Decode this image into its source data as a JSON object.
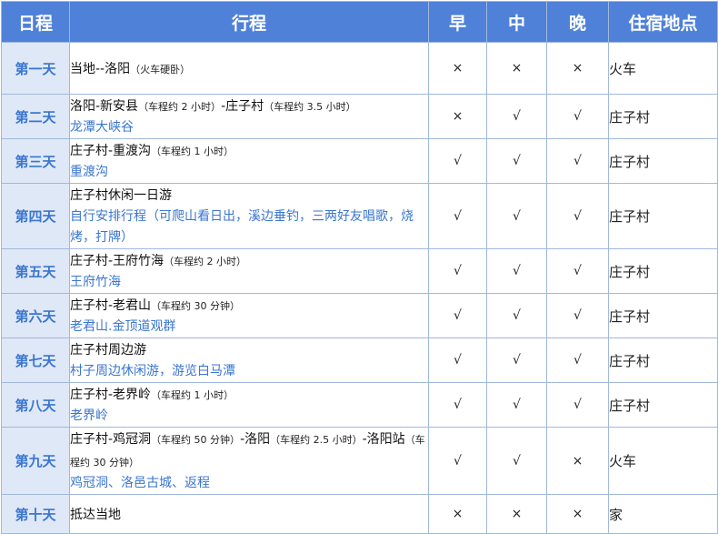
{
  "header": {
    "day": "日程",
    "route": "行程",
    "breakfast": "早",
    "lunch": "中",
    "dinner": "晚",
    "stay": "住宿地点"
  },
  "rows": [
    {
      "day": "第一天",
      "segments": [
        {
          "t": "main",
          "v": "当地--洛阳"
        },
        {
          "t": "note",
          "v": "（火车硬卧）"
        }
      ],
      "scenic": "",
      "b": "×",
      "l": "×",
      "d": "×",
      "stay": "火车"
    },
    {
      "day": "第二天",
      "segments": [
        {
          "t": "main",
          "v": "洛阳-新安县"
        },
        {
          "t": "note",
          "v": "（车程约 2 小时）"
        },
        {
          "t": "main",
          "v": "-庄子村"
        },
        {
          "t": "note",
          "v": "（车程约 3.5 小时）"
        }
      ],
      "scenic": "龙潭大峡谷",
      "b": "×",
      "l": "√",
      "d": "√",
      "stay": "庄子村"
    },
    {
      "day": "第三天",
      "segments": [
        {
          "t": "main",
          "v": "庄子村-重渡沟"
        },
        {
          "t": "note",
          "v": "（车程约 1 小时）"
        }
      ],
      "scenic": "重渡沟",
      "b": "√",
      "l": "√",
      "d": "√",
      "stay": "庄子村"
    },
    {
      "day": "第四天",
      "segments": [
        {
          "t": "main",
          "v": "庄子村休闲一日游"
        }
      ],
      "scenic": "自行安排行程（可爬山看日出，溪边垂钓，三两好友唱歌，烧烤，打牌）",
      "b": "√",
      "l": "√",
      "d": "√",
      "stay": "庄子村"
    },
    {
      "day": "第五天",
      "segments": [
        {
          "t": "main",
          "v": "庄子村-王府竹海"
        },
        {
          "t": "note",
          "v": "（车程约 2 小时）"
        }
      ],
      "scenic": "王府竹海",
      "b": "√",
      "l": "√",
      "d": "√",
      "stay": "庄子村"
    },
    {
      "day": "第六天",
      "segments": [
        {
          "t": "main",
          "v": "庄子村-老君山"
        },
        {
          "t": "note",
          "v": "（车程约 30 分钟）"
        }
      ],
      "scenic": "老君山.金顶道观群",
      "b": "√",
      "l": "√",
      "d": "√",
      "stay": "庄子村"
    },
    {
      "day": "第七天",
      "segments": [
        {
          "t": "main",
          "v": "庄子村周边游"
        }
      ],
      "scenic": "村子周边休闲游，游览白马潭",
      "b": "√",
      "l": "√",
      "d": "√",
      "stay": "庄子村"
    },
    {
      "day": "第八天",
      "segments": [
        {
          "t": "main",
          "v": "庄子村-老界岭"
        },
        {
          "t": "note",
          "v": "（车程约 1 小时）"
        }
      ],
      "scenic": "老界岭",
      "b": "√",
      "l": "√",
      "d": "√",
      "stay": "庄子村"
    },
    {
      "day": "第九天",
      "segments": [
        {
          "t": "main",
          "v": "庄子村-鸡冠洞"
        },
        {
          "t": "note",
          "v": "（车程约 50 分钟）"
        },
        {
          "t": "main",
          "v": "-洛阳"
        },
        {
          "t": "note",
          "v": "（车程约 2.5 小时）"
        },
        {
          "t": "main",
          "v": "-洛阳站"
        },
        {
          "t": "note",
          "v": "（车程约 30 分钟）"
        }
      ],
      "scenic": "鸡冠洞、洛邑古城、返程",
      "b": "√",
      "l": "√",
      "d": "×",
      "stay": "火车"
    },
    {
      "day": "第十天",
      "segments": [
        {
          "t": "main",
          "v": "抵达当地"
        }
      ],
      "scenic": "",
      "b": "×",
      "l": "×",
      "d": "×",
      "stay": "家"
    }
  ]
}
